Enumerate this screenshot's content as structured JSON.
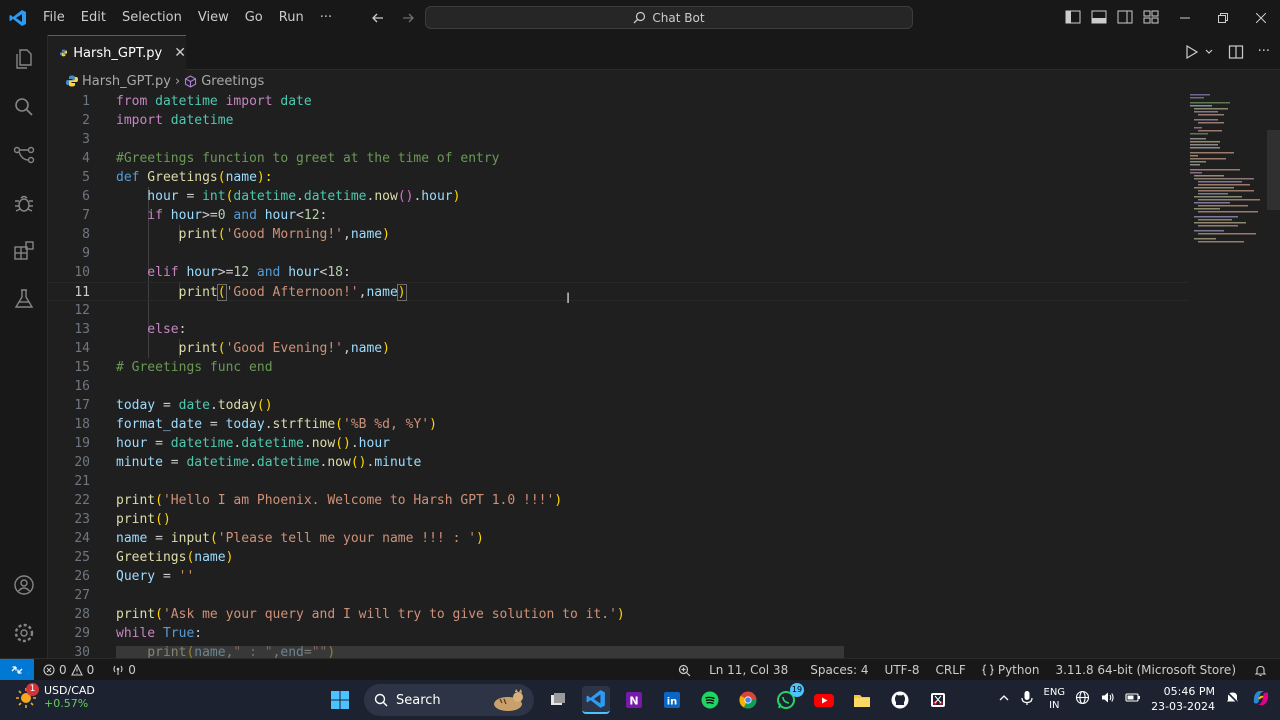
{
  "menu": [
    "File",
    "Edit",
    "Selection",
    "View",
    "Go",
    "Run",
    "···"
  ],
  "search": {
    "label": "Chat Bot"
  },
  "tab": {
    "label": "Harsh_GPT.py",
    "close": "✕"
  },
  "breadcrumb": {
    "file": "Harsh_GPT.py",
    "sep": "›",
    "symbol": "Greetings"
  },
  "editor": {
    "current_line": 11,
    "lines": [
      "1",
      "2",
      "3",
      "4",
      "5",
      "6",
      "7",
      "8",
      "9",
      "10",
      "11",
      "12",
      "13",
      "14",
      "15",
      "16",
      "17",
      "18",
      "19",
      "20",
      "21",
      "22",
      "23",
      "24",
      "25",
      "26",
      "27",
      "28",
      "29",
      "30"
    ],
    "code": {
      "l1": {
        "a": "from",
        "b": " datetime ",
        "c": "import",
        "d": " date"
      },
      "l2": {
        "a": "import",
        "b": " datetime"
      },
      "l4": "#Greetings function to greet at the time of entry",
      "l5": {
        "a": "def",
        "b": " Greetings",
        "c": "(",
        "d": "name",
        "e": "):"
      },
      "l6": {
        "a": "    hour",
        "b": " = ",
        "c": "int",
        "d": "(",
        "e": "datetime",
        "f": ".",
        "g": "datetime",
        "h": ".",
        "i": "now",
        "j": "()",
        "k": ".",
        "l": "hour",
        "m": ")"
      },
      "l7": {
        "a": "    if",
        "b": " hour",
        "c": ">=",
        "d": "0",
        "e": " and",
        "f": " hour",
        "g": "<",
        "h": "12",
        "i": ":"
      },
      "l8": {
        "a": "        print",
        "b": "(",
        "c": "'Good Morning!'",
        "d": ",",
        "e": "name",
        "f": ")"
      },
      "l10": {
        "a": "    elif",
        "b": " hour",
        "c": ">=",
        "d": "12",
        "e": " and",
        "f": " hour",
        "g": "<",
        "h": "18",
        "i": ":"
      },
      "l11": {
        "a": "        print",
        "b": "(",
        "c": "'Good Afternoon!'",
        "d": ",",
        "e": "name",
        "f": ")"
      },
      "l13": {
        "a": "    else",
        "b": ":"
      },
      "l14": {
        "a": "        print",
        "b": "(",
        "c": "'Good Evening!'",
        "d": ",",
        "e": "name",
        "f": ")"
      },
      "l15": "# Greetings func end",
      "l17": {
        "a": "today",
        "b": " = ",
        "c": "date",
        "d": ".",
        "e": "today",
        "f": "()"
      },
      "l18": {
        "a": "format_date",
        "b": " = ",
        "c": "today",
        "d": ".",
        "e": "strftime",
        "f": "(",
        "g": "'%B %d, %Y'",
        "h": ")"
      },
      "l19": {
        "a": "hour",
        "b": " = ",
        "c": "datetime",
        "d": ".",
        "e": "datetime",
        "f": ".",
        "g": "now",
        "h": "()",
        "i": ".",
        "j": "hour"
      },
      "l20": {
        "a": "minute",
        "b": " = ",
        "c": "datetime",
        "d": ".",
        "e": "datetime",
        "f": ".",
        "g": "now",
        "h": "()",
        "i": ".",
        "j": "minute"
      },
      "l22": {
        "a": "print",
        "b": "(",
        "c": "'Hello I am Phoenix. Welcome to Harsh GPT 1.0 !!!'",
        "d": ")"
      },
      "l23": {
        "a": "print",
        "b": "()"
      },
      "l24": {
        "a": "name",
        "b": " = ",
        "c": "input",
        "d": "(",
        "e": "'Please tell me your name !!! : '",
        "f": ")"
      },
      "l25": {
        "a": "Greetings",
        "b": "(",
        "c": "name",
        "d": ")"
      },
      "l26": {
        "a": "Query",
        "b": " = ",
        "c": "''"
      },
      "l28": {
        "a": "print",
        "b": "(",
        "c": "'Ask me your query and I will try to give solution to it.'",
        "d": ")"
      },
      "l29": {
        "a": "while",
        "b": " True",
        "c": ":"
      },
      "l30": {
        "a": "    print",
        "b": "(",
        "c": "name",
        "d": ",",
        "e": "\" : \"",
        "f": ",",
        "g": "end",
        "h": "=",
        "i": "\"\"",
        "j": ")"
      }
    }
  },
  "status": {
    "errors": "0",
    "warnings": "0",
    "ports": "0",
    "position": "Ln 11, Col 38",
    "spaces": "Spaces: 4",
    "encoding": "UTF-8",
    "eol": "CRLF",
    "language": "Python",
    "interpreter": "3.11.8 64-bit (Microsoft Store)"
  },
  "taskbar": {
    "weather_badge": "1",
    "ticker": "USD/CAD",
    "ticker_change": "+0.57%",
    "search": "Search",
    "lang_top": "ENG",
    "lang_bottom": "IN",
    "time": "05:46 PM",
    "date": "23-03-2024",
    "whatsapp_badge": "19"
  },
  "colors": {
    "accent": "#0078d4",
    "keyword": "#569cd6",
    "string": "#ce9178",
    "function": "#dcdcaa",
    "comment": "#6a9955"
  }
}
